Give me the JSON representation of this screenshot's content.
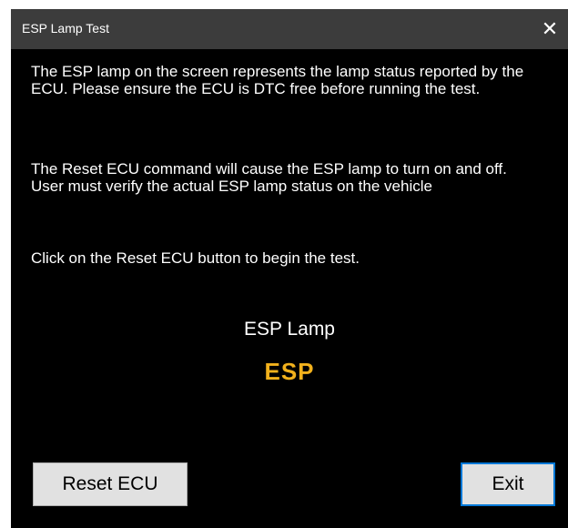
{
  "window": {
    "title": "ESP Lamp Test",
    "close_glyph": "✕"
  },
  "instructions": {
    "paragraph1": "The ESP lamp on the screen represents the lamp status reported by the ECU.  Please ensure the ECU is DTC free before running the test.",
    "paragraph2": "The Reset ECU command will cause the ESP lamp to turn on and off.  User must verify the actual ESP lamp status on the vehicle",
    "paragraph3": "Click on the Reset ECU button to begin the test."
  },
  "lamp": {
    "label": "ESP Lamp",
    "indicator_text": "ESP",
    "indicator_color": "#f2b11c"
  },
  "buttons": {
    "reset_label": "Reset ECU",
    "exit_label": "Exit"
  },
  "colors": {
    "background": "#000000",
    "titlebar": "#3c3c3c",
    "button_face": "#e1e1e1",
    "focus_border": "#0078d7"
  }
}
